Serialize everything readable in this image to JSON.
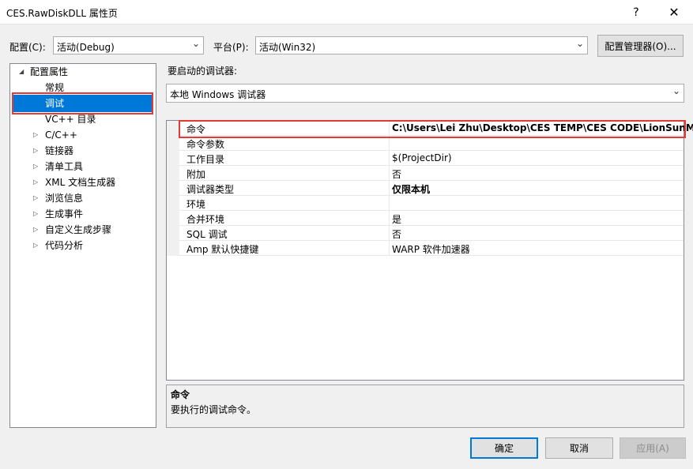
{
  "window": {
    "title": "CES.RawDiskDLL 属性页",
    "help_label": "?",
    "close_label": "✕"
  },
  "toolbar": {
    "config_label": "配置(C):",
    "config_value": "活动(Debug)",
    "platform_label": "平台(P):",
    "platform_value": "活动(Win32)",
    "config_manager_label": "配置管理器(O)..."
  },
  "tree": {
    "root_label": "配置属性",
    "items": [
      {
        "label": "常规",
        "expandable": false
      },
      {
        "label": "调试",
        "expandable": false,
        "selected": true
      },
      {
        "label": "VC++ 目录",
        "expandable": false
      },
      {
        "label": "C/C++",
        "expandable": true
      },
      {
        "label": "链接器",
        "expandable": true
      },
      {
        "label": "清单工具",
        "expandable": true
      },
      {
        "label": "XML 文档生成器",
        "expandable": true
      },
      {
        "label": "浏览信息",
        "expandable": true
      },
      {
        "label": "生成事件",
        "expandable": true
      },
      {
        "label": "自定义生成步骤",
        "expandable": true
      },
      {
        "label": "代码分析",
        "expandable": true
      }
    ]
  },
  "debugger": {
    "label": "要启动的调试器:",
    "value": "本地 Windows 调试器"
  },
  "properties": [
    {
      "name": "命令",
      "value": "C:\\Users\\Lei Zhu\\Desktop\\CES TEMP\\CES CODE\\LionSunMA",
      "bold": true
    },
    {
      "name": "命令参数",
      "value": ""
    },
    {
      "name": "工作目录",
      "value": "$(ProjectDir)"
    },
    {
      "name": "附加",
      "value": "否"
    },
    {
      "name": "调试器类型",
      "value": "仅限本机",
      "bold": true
    },
    {
      "name": "环境",
      "value": ""
    },
    {
      "name": "合并环境",
      "value": "是"
    },
    {
      "name": "SQL 调试",
      "value": "否"
    },
    {
      "name": "Amp 默认快捷键",
      "value": "WARP 软件加速器"
    }
  ],
  "description": {
    "title": "命令",
    "text": "要执行的调试命令。"
  },
  "buttons": {
    "ok": "确定",
    "cancel": "取消",
    "apply": "应用(A)"
  },
  "icons": {
    "expand": "triangle-right-icon",
    "collapse": "triangle-down-icon",
    "dropdown": "chevron-down-icon"
  },
  "colors": {
    "selection": "#0078d7",
    "highlight_box": "#e53935"
  }
}
